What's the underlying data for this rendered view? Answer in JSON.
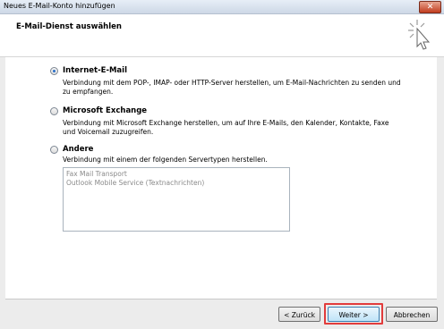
{
  "window": {
    "title": "Neues E-Mail-Konto hinzufügen"
  },
  "header": {
    "title": "E-Mail-Dienst auswählen"
  },
  "options": [
    {
      "label": "Internet-E-Mail",
      "selected": true,
      "description": "Verbindung mit dem POP-, IMAP- oder HTTP-Server herstellen, um E-Mail-Nachrichten zu senden und zu empfangen."
    },
    {
      "label": "Microsoft Exchange",
      "selected": false,
      "description": "Verbindung mit Microsoft Exchange herstellen, um auf Ihre E-Mails, den Kalender, Kontakte, Faxe und Voicemail zuzugreifen."
    },
    {
      "label": "Andere",
      "selected": false,
      "description": "Verbindung mit einem der folgenden Servertypen herstellen.",
      "list_items": [
        "Fax Mail Transport",
        "Outlook Mobile Service (Textnachrichten)"
      ]
    }
  ],
  "buttons": {
    "back": "< Zurück",
    "next": "Weiter >",
    "cancel": "Abbrechen"
  },
  "colors": {
    "highlight": "#e23c3c",
    "radio_dot": "#2a6fc9"
  }
}
